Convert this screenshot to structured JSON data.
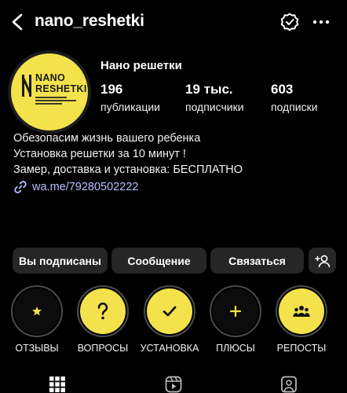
{
  "header": {
    "username": "nano_reshetki",
    "back_icon": "chevron-left-icon",
    "threads_icon": "threads-icon",
    "more_icon": "more-horizontal-icon"
  },
  "profile": {
    "avatar": {
      "logo_line1": "NANO",
      "logo_line2": "RESHETKI",
      "brand_color": "#f4e24c"
    },
    "display_name": "Нано решетки",
    "stats": [
      {
        "value": "196",
        "label": "публикации"
      },
      {
        "value": "19 тыс.",
        "label": "подписчики"
      },
      {
        "value": "603",
        "label": "подписки"
      }
    ],
    "bio": [
      "Обезопасим жизнь вашего ребенка",
      "Установка решетки за 10 минут !",
      "Замер, доставка и установка: БЕСПЛАТНО"
    ],
    "link": {
      "icon": "link-icon",
      "text": "wa.me/79280502222",
      "color": "#b9bfff"
    }
  },
  "actions": {
    "following": "Вы подписаны",
    "message": "Сообщение",
    "contact": "Связаться",
    "add_user_icon": "add-user-icon"
  },
  "highlights": [
    {
      "label": "ОТЗЫВЫ",
      "icon": "star-icon",
      "style": "dark"
    },
    {
      "label": "ВОПРОСЫ",
      "icon": "question-icon",
      "style": "yellow"
    },
    {
      "label": "УСТАНОВКА",
      "icon": "checkmark-icon",
      "style": "yellow"
    },
    {
      "label": "ПЛЮСЫ",
      "icon": "plus-icon",
      "style": "dark"
    },
    {
      "label": "РЕПОСТЫ",
      "icon": "people-icon",
      "style": "yellow"
    }
  ],
  "tabs": [
    {
      "icon": "grid-icon",
      "active": true
    },
    {
      "icon": "reels-icon",
      "active": false
    },
    {
      "icon": "tagged-icon",
      "active": false
    }
  ]
}
